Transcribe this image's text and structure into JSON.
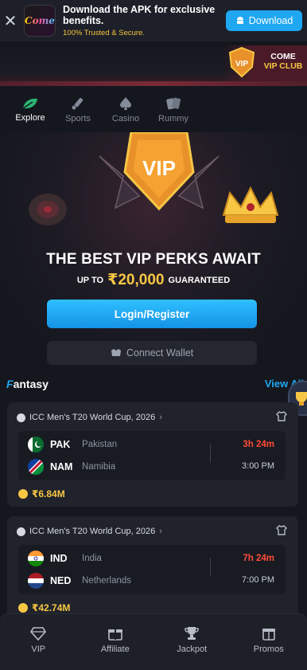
{
  "apk_banner": {
    "app_logo_text": "Come",
    "title": "Download the APK for exclusive benefits.",
    "subtitle": "100% Trusted & Secure.",
    "download_label": "Download"
  },
  "promo_strip": {
    "vip_label": "VIP",
    "line1": "COME",
    "line2": "VIP CLUB"
  },
  "tabs": [
    {
      "label": "Explore",
      "icon": "leaf-icon",
      "active": true
    },
    {
      "label": "Sports",
      "icon": "cricket-bat-icon",
      "active": false
    },
    {
      "label": "Casino",
      "icon": "spade-icon",
      "active": false
    },
    {
      "label": "Rummy",
      "icon": "cards-icon",
      "active": false
    }
  ],
  "hero": {
    "vip_label": "VIP",
    "heading": "THE BEST VIP PERKS AWAIT",
    "sub_prefix": "UP TO",
    "sub_amount": "₹20,000",
    "sub_suffix": "GUARANTEED",
    "login_label": "Login/Register",
    "wallet_label": "Connect Wallet"
  },
  "fantasy": {
    "title_first": "F",
    "title_rest": "antasy",
    "view_all": "View All",
    "matches": [
      {
        "league": "ICC Men's T20 World Cup, 2026",
        "team1_code": "PAK",
        "team1_name": "Pakistan",
        "team2_code": "NAM",
        "team2_name": "Namibia",
        "countdown": "3h 24m",
        "time": "3:00 PM",
        "prize": "₹6.84M"
      },
      {
        "league": "ICC Men's T20 World Cup, 2026",
        "team1_code": "IND",
        "team1_name": "India",
        "team2_code": "NED",
        "team2_name": "Netherlands",
        "countdown": "7h 24m",
        "time": "7:00 PM",
        "prize": "₹42.74M"
      }
    ]
  },
  "bottom_nav": [
    {
      "label": "VIP",
      "icon": "diamond-icon"
    },
    {
      "label": "Affiliate",
      "icon": "gift-icon"
    },
    {
      "label": "Jackpot",
      "icon": "trophy-icon"
    },
    {
      "label": "Promos",
      "icon": "present-icon"
    }
  ],
  "colors": {
    "accent": "#1fa7f1",
    "gold": "#f7c744",
    "countdown": "#ff4b37",
    "background": "#15171e"
  }
}
